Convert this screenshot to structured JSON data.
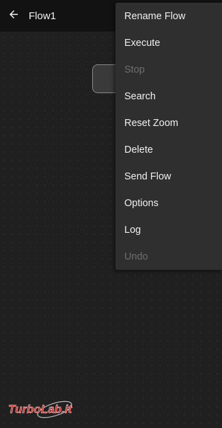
{
  "appbar": {
    "title": "Flow1",
    "back_icon": "arrow-left-icon"
  },
  "menu": {
    "items": [
      {
        "label": "Rename Flow",
        "enabled": true
      },
      {
        "label": "Execute",
        "enabled": true
      },
      {
        "label": "Stop",
        "enabled": false
      },
      {
        "label": "Search",
        "enabled": true
      },
      {
        "label": "Reset Zoom",
        "enabled": true
      },
      {
        "label": "Delete",
        "enabled": true
      },
      {
        "label": "Send Flow",
        "enabled": true
      },
      {
        "label": "Options",
        "enabled": true
      },
      {
        "label": "Log",
        "enabled": true
      },
      {
        "label": "Undo",
        "enabled": false
      }
    ]
  },
  "watermark": {
    "text": "TurboLab.it"
  },
  "colors": {
    "appbar": "#121212",
    "canvas": "#202020",
    "menu": "#2f2f2f",
    "text": "#f0f0f0",
    "disabled": "#6f6f6f",
    "watermark": "#d9302c"
  }
}
